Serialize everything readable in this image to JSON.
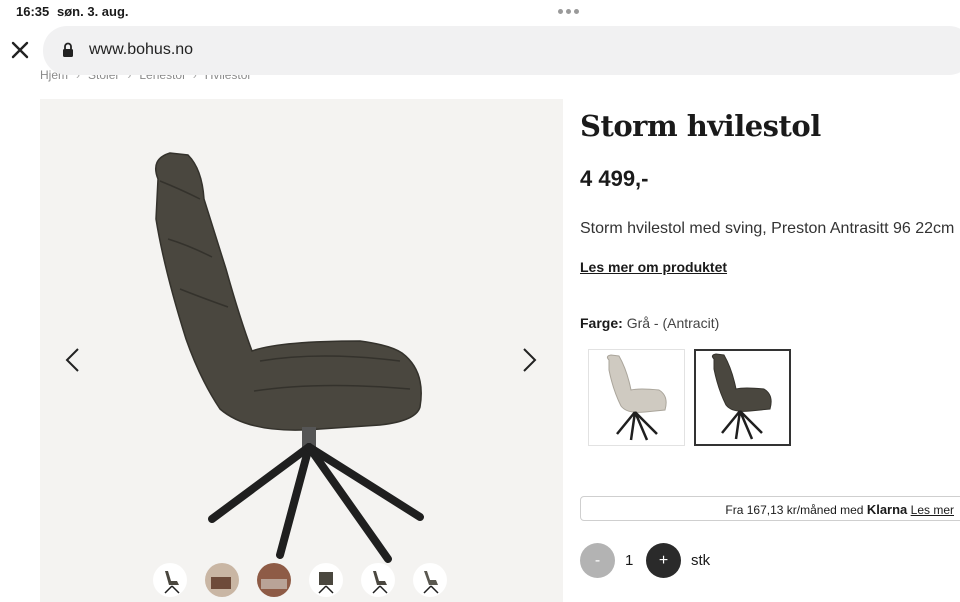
{
  "status": {
    "time": "16:35",
    "date": "søn. 3. aug."
  },
  "browser": {
    "url": "www.bohus.no"
  },
  "breadcrumb": [
    "Hjem",
    "Stoler",
    "Lenestol",
    "Hvilestol"
  ],
  "product": {
    "title": "Storm hvilestol",
    "price": "4 499,-",
    "description": "Storm hvilestol med sving, Preston Antrasitt 96 22cm",
    "read_more": "Les mer om produktet",
    "color_label": "Farge:",
    "color_value": "Grå - (Antracit)"
  },
  "colors": {
    "chair_dark": "#4a473f",
    "chair_light": "#cfcac1",
    "leg": "#1f1f1f",
    "selected_border": "#333333"
  },
  "financing": {
    "text": "Fra 167,13 kr/måned med",
    "brand": "Klarna",
    "link": "Les mer"
  },
  "quantity": {
    "minus": "-",
    "value": "1",
    "plus": "+",
    "unit": "stk"
  }
}
